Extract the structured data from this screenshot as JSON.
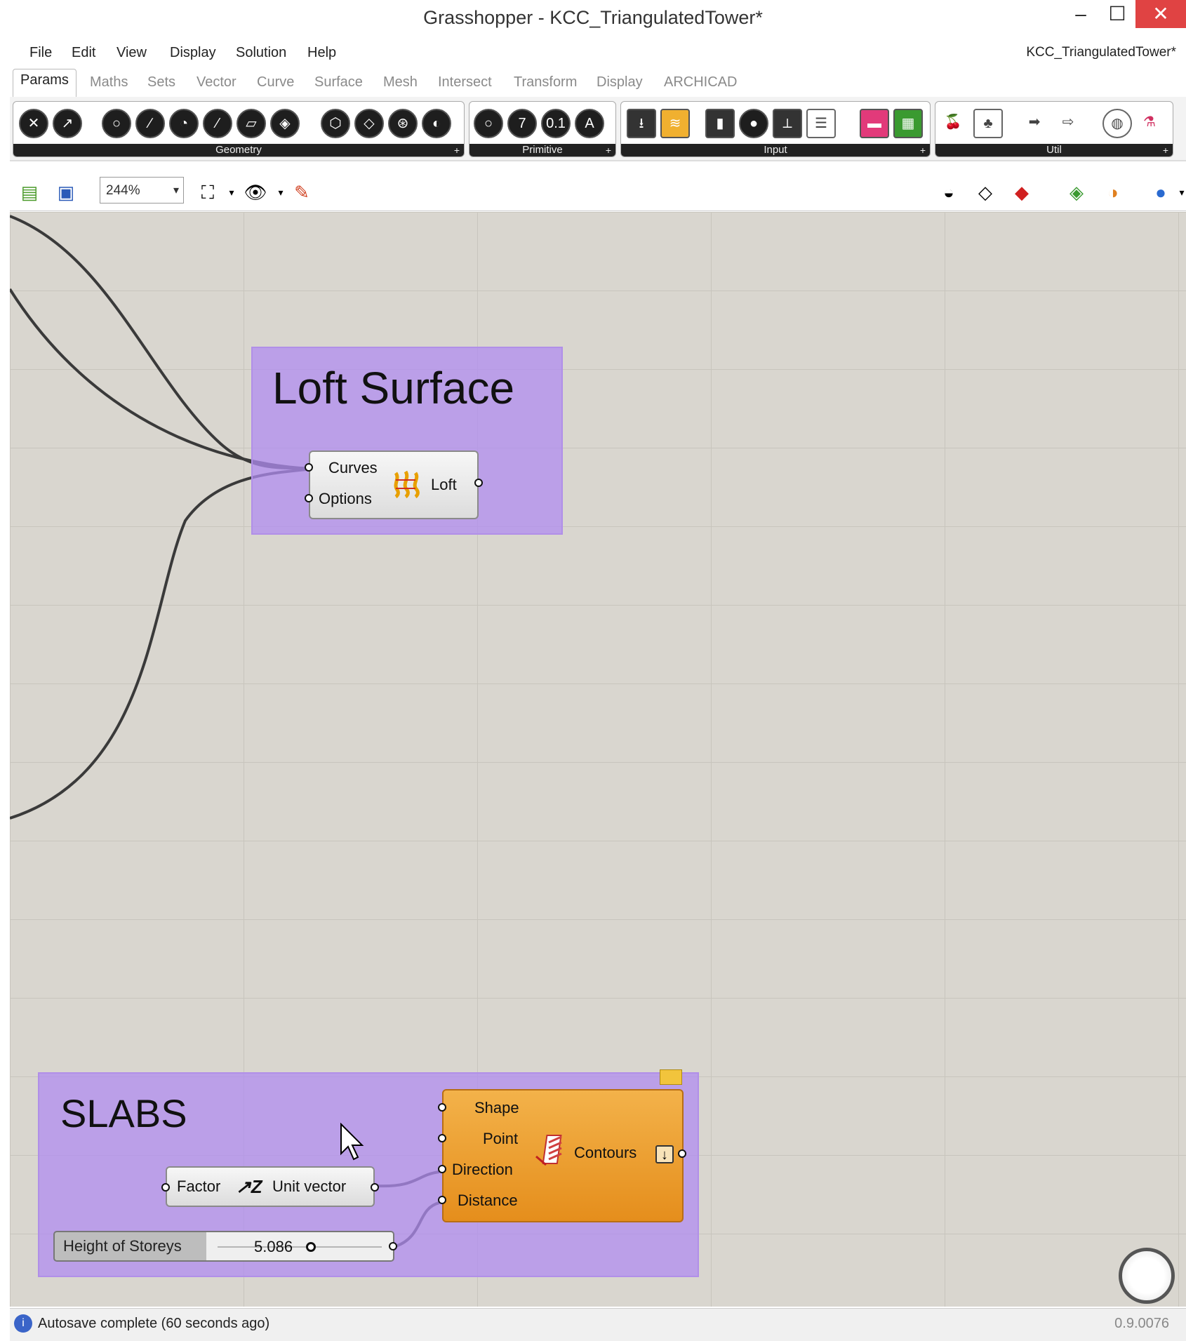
{
  "window": {
    "title": "Grasshopper - KCC_TriangulatedTower*",
    "minimize": "–",
    "maximize": "☐",
    "close": "✕"
  },
  "menu": {
    "items": [
      "File",
      "Edit",
      "View",
      "Display",
      "Solution",
      "Help"
    ],
    "doc_name": "KCC_TriangulatedTower*"
  },
  "tabs": [
    "Params",
    "Maths",
    "Sets",
    "Vector",
    "Curve",
    "Surface",
    "Mesh",
    "Intersect",
    "Transform",
    "Display",
    "ARCHICAD"
  ],
  "active_tab": "Params",
  "ribbon": {
    "groups": [
      "Geometry",
      "Primitive",
      "Input",
      "Util"
    ],
    "expand": "+"
  },
  "canvas_toolbar": {
    "zoom": "244%"
  },
  "groups": {
    "loft": {
      "title": "Loft Surface"
    },
    "slabs": {
      "title": "SLABS"
    }
  },
  "components": {
    "loft": {
      "inputs": [
        "Curves",
        "Options"
      ],
      "output": "Loft"
    },
    "unit_vector": {
      "input": "Factor",
      "output": "Unit vector"
    },
    "contours": {
      "inputs": [
        "Shape",
        "Point",
        "Direction",
        "Distance"
      ],
      "output": "Contours"
    },
    "slider": {
      "name": "Height of Storeys",
      "value": "5.086"
    }
  },
  "status": {
    "message": "Autosave complete (60 seconds ago)",
    "version": "0.9.0076"
  }
}
